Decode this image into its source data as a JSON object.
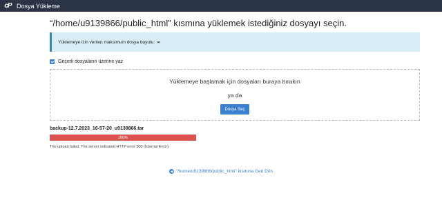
{
  "topbar": {
    "logo_text": "cP",
    "title": "Dosya Yükleme"
  },
  "heading": "“/home/u9139866/public_html” kısmına yüklemek istediğiniz dosyayı seçin.",
  "alert": {
    "text": "Yüklemeye izin verilen maksimum dosya boyutu:",
    "value": "∞"
  },
  "overwrite": {
    "label": "Geçerli dosyaların üzerine yaz",
    "checked": true
  },
  "dropzone": {
    "drop_text": "Yüklemeye başlamak için dosyaları buraya bırakın",
    "or_text": "ya da",
    "select_button": "Dosya Seç"
  },
  "upload": {
    "file_name": "backup-12.7.2023_16-57-20_u9139866.tar",
    "progress_label": "100%",
    "progress_fraction": 1.0,
    "progress_color": "#d9534f",
    "error_message": "The upload failed. The server indicated HTTP error 500 (Internal Error)."
  },
  "back_link": {
    "icon": "arrow-left-circle-icon",
    "text": "“/home/u9139866/public_html” kısmına Geri Dön"
  },
  "colors": {
    "topbar": "#2b3346",
    "accent": "#3a7fd0",
    "alert_bg": "#d9edf7"
  }
}
